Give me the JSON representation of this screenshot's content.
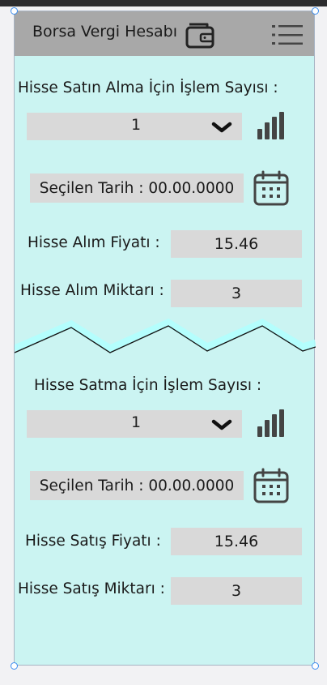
{
  "status_bar": {
    "text": ""
  },
  "header": {
    "title": "Borsa Vergi Hesabı",
    "wallet_icon": "wallet-icon",
    "menu_icon": "hamburger-menu-icon"
  },
  "buy": {
    "count_label": "Hisse Satın Alma İçin İşlem Sayısı :",
    "count_value": "1",
    "date_text": "Seçilen Tarih : 00.00.0000",
    "price_label": "Hisse Alım Fiyatı :",
    "price_value": "15.46",
    "qty_label": "Hisse Alım Miktarı :",
    "qty_value": "3"
  },
  "sell": {
    "count_label": "Hisse Satma İçin İşlem Sayısı :",
    "count_value": "1",
    "date_text": "Seçilen Tarih : 00.00.0000",
    "price_label": "Hisse Satış Fiyatı :",
    "price_value": "15.46",
    "qty_label": "Hisse Satış Miktarı :",
    "qty_value": "3"
  },
  "colors": {
    "background": "#cbf4f2",
    "header": "#a8a8a8",
    "field": "#d9d9d9",
    "selection_handle": "#3b8df0"
  }
}
